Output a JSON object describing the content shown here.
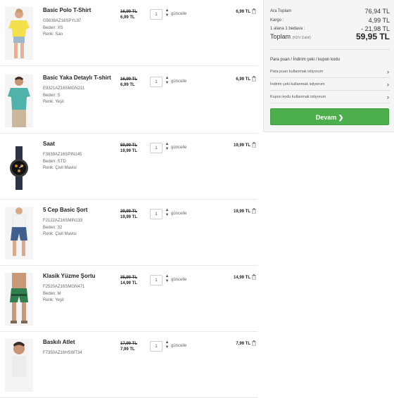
{
  "items": [
    {
      "name": "Basic Polo T-Shirt",
      "code": "G5639AZ16SPYL97",
      "size_label": "Beden: XS",
      "color_label": "Renk: Sarı",
      "old_price": "16,99 TL",
      "new_price": "6,99 TL",
      "qty": "1",
      "update": "güncelle",
      "total": "6,99 TL",
      "image": "yellow-polo-tshirt"
    },
    {
      "name": "Basic Yaka Detaylı T-shirt",
      "code": "E9321AZ16SMGN211",
      "size_label": "Beden: S",
      "color_label": "Renk: Yeşil",
      "old_price": "16,99 TL",
      "new_price": "6,99 TL",
      "qty": "1",
      "update": "güncelle",
      "total": "6,99 TL",
      "image": "green-tshirt"
    },
    {
      "name": "Saat",
      "code": "F3839AZ16SPIN145",
      "size_label": "Beden: STD",
      "color_label": "Renk: Çivit Mavisi",
      "old_price": "59,99 TL",
      "new_price": "19,99 TL",
      "qty": "1",
      "update": "güncelle",
      "total": "19,99 TL",
      "image": "wrist-watch"
    },
    {
      "name": "5 Cep Basic Şort",
      "code": "F2122AZ16SMIN133",
      "size_label": "Beden: 32",
      "color_label": "Renk: Çivit Mavisi",
      "old_price": "39,99 TL",
      "new_price": "19,99 TL",
      "qty": "1",
      "update": "güncelle",
      "total": "19,99 TL",
      "image": "denim-shorts"
    },
    {
      "name": "Klasik Yüzme Şortu",
      "code": "F2520AZ16SMGN471",
      "size_label": "Beden: M",
      "color_label": "Renk: Yeşil",
      "old_price": "35,99 TL",
      "new_price": "14,99 TL",
      "qty": "1",
      "update": "güncelle",
      "total": "14,99 TL",
      "image": "swim-shorts"
    },
    {
      "name": "Baskılı Atlet",
      "code": "F7350AZ16HSWT34",
      "size_label": "",
      "color_label": "",
      "old_price": "17,99 TL",
      "new_price": "7,99 TL",
      "qty": "1",
      "update": "güncelle",
      "total": "7,99 TL",
      "image": "printed-tank"
    }
  ],
  "summary": {
    "subtotal_label": "Ara Toplam",
    "subtotal_value": "76,94 TL",
    "shipping_label": "Kargo :",
    "shipping_value": "4,99 TL",
    "discount_label": "1 alana 1 bedava :",
    "discount_value": "- 21,98 TL",
    "total_label": "Toplam",
    "total_note": "(KDV Dahil)",
    "total_value": "59,95 TL"
  },
  "discounts": {
    "title": "Para puan / İndirim çeki / kupon kodu",
    "options": [
      "Para puan kullanmak istiyorum",
      "İndirim çeki kullanmak istiyorum",
      "Kupon kodu kullanmak istiyorum"
    ]
  },
  "continue_button": "Devam",
  "colors": {
    "accent": "#4cae4c"
  }
}
